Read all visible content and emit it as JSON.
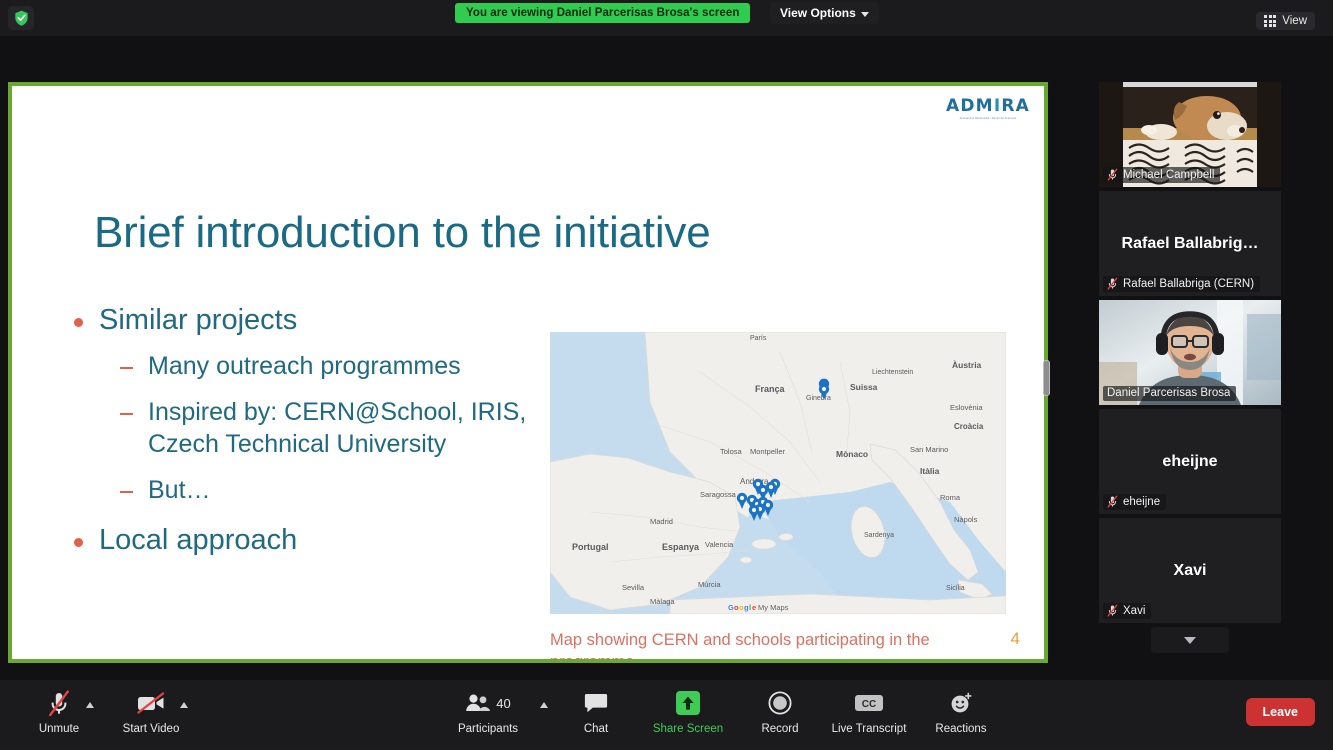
{
  "topbar": {
    "encryption_icon": "shield-check-icon",
    "viewing_banner": "You are viewing Daniel Parcerisas Brosa's screen",
    "view_options_label": "View Options",
    "view_options_icon": "chevron-down-icon",
    "view_button_label": "View",
    "view_button_icon": "grid-icon",
    "banner_color": "#2fcc4f"
  },
  "share": {
    "border_color": "#6aa832",
    "drag_handle_icon": "resize-handle-icon"
  },
  "slide": {
    "logo": {
      "text": "ADMIRA",
      "tagline": "Aplicacions Multimedia i Recursos Avançats"
    },
    "title": "Brief introduction to the initiative",
    "title_color": "#1a6a86",
    "bullet_color": "#e0604c",
    "body_color": "#1f6a80",
    "bullets": [
      {
        "text": "Similar projects",
        "children": [
          "Many outreach programmes",
          "Inspired by: CERN@School, IRIS, Czech Technical University",
          "But…"
        ]
      },
      {
        "text": "Local approach",
        "children": []
      }
    ],
    "map_caption": "Map showing CERN and schools participating in the programme",
    "map_caption_color": "#dd7060",
    "page_number": "4",
    "page_number_color": "#e9a13b",
    "map": {
      "provider": "Google My Maps",
      "attribution": "Google My Maps",
      "labels": [
        "França",
        "Suissa",
        "Liechtenstein",
        "Àustria",
        "Eslovènia",
        "Croàcia",
        "Mònaco",
        "Itàlia",
        "San Marino",
        "Andorra",
        "Espanya",
        "Portugal",
        "Madrid",
        "Saragossa",
        "Valencia",
        "Sevilla",
        "Màlaga",
        "Múrcia",
        "Roma",
        "Nàpols",
        "Ginebra",
        "París",
        "Sardenya",
        "Sicília"
      ],
      "pin_color": "#1a73c8",
      "pin_count": 12
    }
  },
  "sidebar": {
    "participants": [
      {
        "name": "Michael Campbell",
        "display_name": "Michael Campbell",
        "video": true,
        "muted": true,
        "active_speaker": false,
        "video_kind": "dog-on-rug"
      },
      {
        "name": "Rafael Ballabriga (CERN)",
        "display_name": "Rafael  Ballabrig…",
        "video": false,
        "muted": true,
        "active_speaker": false,
        "video_kind": "none"
      },
      {
        "name": "Daniel Parcerisas Brosa",
        "display_name": "Daniel Parcerisas Brosa",
        "video": true,
        "muted": false,
        "active_speaker": true,
        "video_kind": "man-with-headphones"
      },
      {
        "name": "eheijne",
        "display_name": "eheijne",
        "video": false,
        "muted": true,
        "active_speaker": false,
        "video_kind": "none"
      },
      {
        "name": "Xavi",
        "display_name": "Xavi",
        "video": false,
        "muted": true,
        "active_speaker": false,
        "video_kind": "none"
      }
    ],
    "scroll_more_icon": "chevron-down-icon",
    "active_border_color": "#d9e94e"
  },
  "toolbar": {
    "items": [
      {
        "id": "unmute",
        "label": "Unmute",
        "icon": "microphone-muted-icon",
        "has_caret": true,
        "active": false
      },
      {
        "id": "start-video",
        "label": "Start Video",
        "icon": "camera-off-icon",
        "has_caret": true,
        "active": false
      },
      {
        "id": "participants",
        "label": "Participants",
        "icon": "participants-icon",
        "count": "40",
        "has_caret": true,
        "active": false
      },
      {
        "id": "chat",
        "label": "Chat",
        "icon": "chat-bubble-icon",
        "has_caret": false,
        "active": false
      },
      {
        "id": "share-screen",
        "label": "Share Screen",
        "icon": "share-screen-up-arrow-icon",
        "has_caret": false,
        "active": true
      },
      {
        "id": "record",
        "label": "Record",
        "icon": "record-circle-icon",
        "has_caret": false,
        "active": false
      },
      {
        "id": "live-transcript",
        "label": "Live Transcript",
        "icon": "closed-caption-icon",
        "has_caret": false,
        "active": false
      },
      {
        "id": "reactions",
        "label": "Reactions",
        "icon": "smiley-reactions-icon",
        "has_caret": false,
        "active": false
      }
    ],
    "leave_label": "Leave",
    "leave_color": "#cc3232",
    "share_active_color": "#3fcc56"
  }
}
